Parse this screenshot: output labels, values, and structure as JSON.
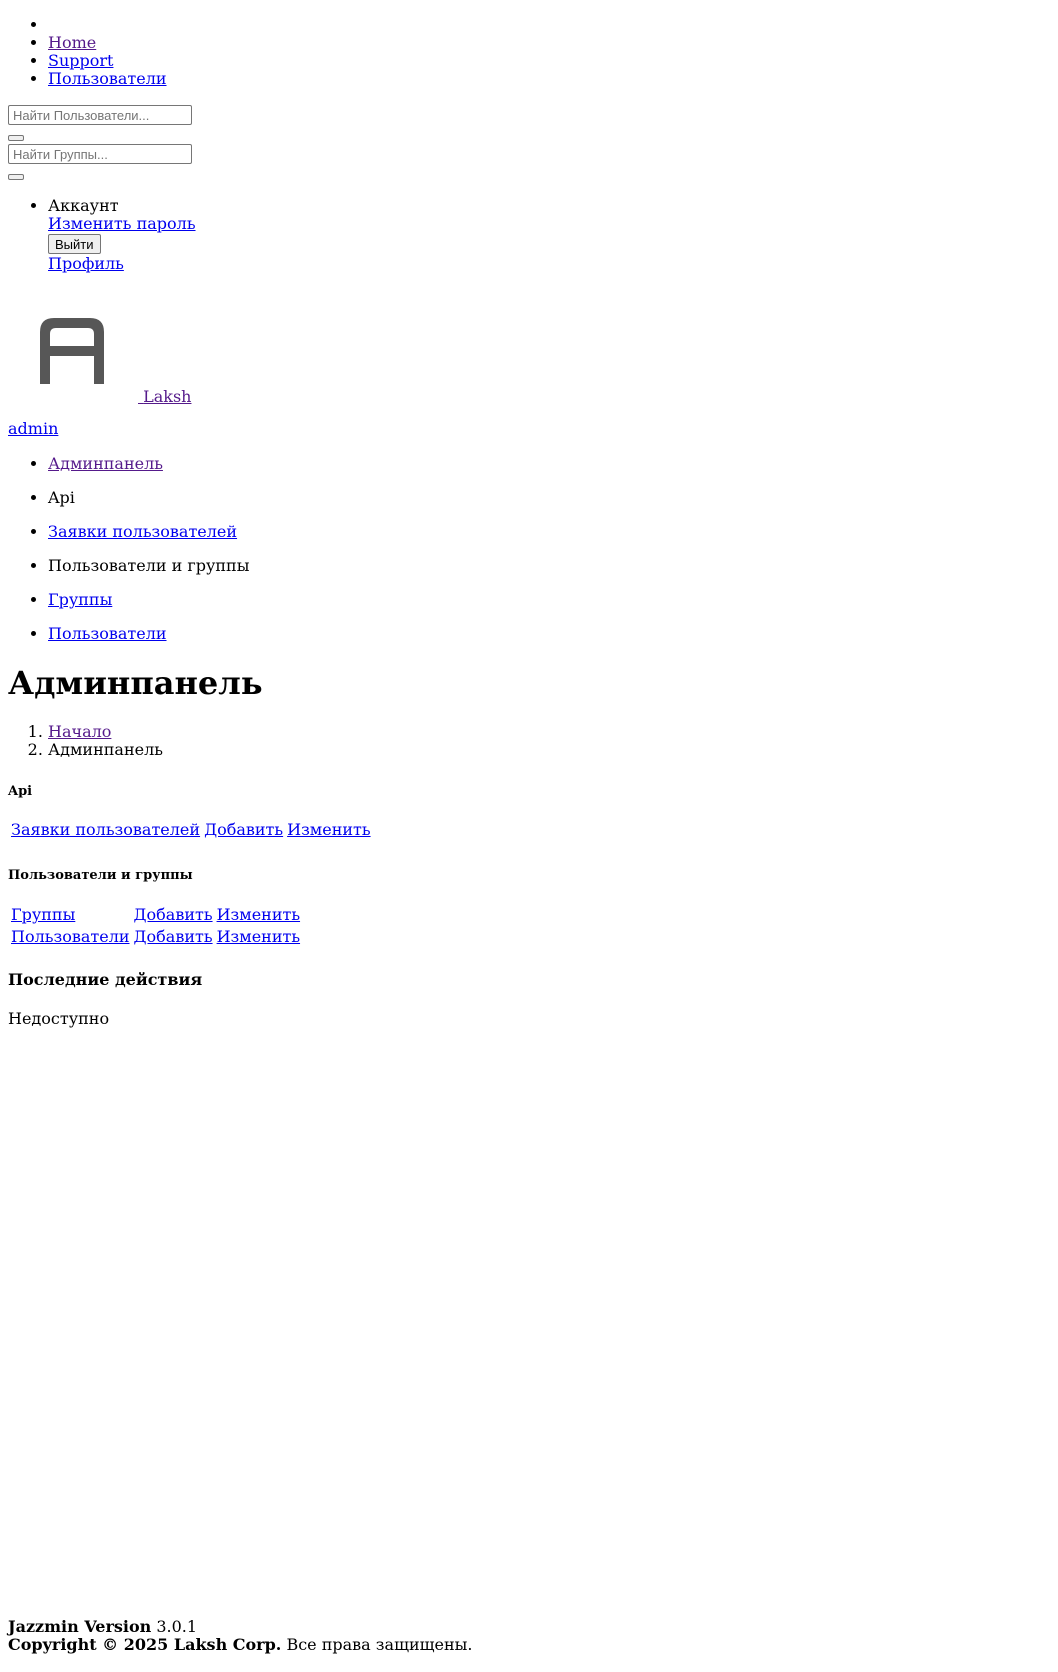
{
  "navbar": {
    "items": [
      {
        "label": ""
      },
      {
        "label": "Home"
      },
      {
        "label": "Support"
      },
      {
        "label": "Пользователи"
      }
    ]
  },
  "search": {
    "users_placeholder": "Найти Пользователи...",
    "groups_placeholder": "Найти Группы..."
  },
  "account": {
    "title": "Аккаунт",
    "change_password": "Изменить пароль",
    "logout": "Выйти",
    "profile": "Профиль"
  },
  "brand": {
    "name": "Laksh",
    "logo_color": "#575757"
  },
  "user": {
    "name": "admin"
  },
  "sidebar": {
    "items": [
      {
        "label": "Админпанель",
        "link": true
      },
      {
        "label": "Api",
        "link": false
      },
      {
        "label": "Заявки пользователей",
        "link": true
      },
      {
        "label": "Пользователи и группы",
        "link": false
      },
      {
        "label": "Группы",
        "link": true
      },
      {
        "label": "Пользователи",
        "link": true
      }
    ]
  },
  "page": {
    "title": "Админпанель"
  },
  "breadcrumb": {
    "home": "Начало",
    "current": "Админпанель"
  },
  "apps": [
    {
      "caption": "Api",
      "models": [
        {
          "name": "Заявки пользователей",
          "add": "Добавить",
          "change": "Изменить"
        }
      ]
    },
    {
      "caption": "Пользователи и группы",
      "models": [
        {
          "name": "Группы",
          "add": "Добавить",
          "change": "Изменить"
        },
        {
          "name": "Пользователи",
          "add": "Добавить",
          "change": "Изменить"
        }
      ]
    }
  ],
  "recent_actions": {
    "title": "Последние действия",
    "empty": "Недоступно"
  },
  "footer": {
    "version_label": "Jazzmin Version",
    "version": "3.0.1",
    "copyright": "Copyright © 2025 Laksh Corp.",
    "rights": "Все права защищены."
  },
  "colors": {
    "link": "#0000ee",
    "visited_link": "#551a8b",
    "text": "#000000"
  }
}
